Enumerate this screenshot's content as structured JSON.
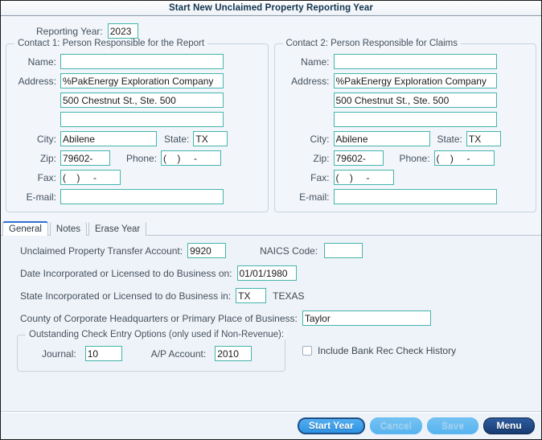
{
  "window": {
    "title": "Start New Unclaimed Property Reporting Year"
  },
  "reporting_year": {
    "label": "Reporting Year:",
    "value": "2023"
  },
  "contact1": {
    "legend": "Contact 1: Person Responsible for the Report",
    "labels": {
      "name": "Name:",
      "address": "Address:",
      "city": "City:",
      "state": "State:",
      "zip": "Zip:",
      "phone": "Phone:",
      "fax": "Fax:",
      "email": "E-mail:"
    },
    "values": {
      "name": "",
      "address1": "%PakEnergy Exploration Company",
      "address2": "500 Chestnut St., Ste. 500",
      "address3": "",
      "city": "Abilene",
      "state": "TX",
      "zip": "79602-",
      "phone": "(    )     -",
      "fax": "(    )     -",
      "email": ""
    }
  },
  "contact2": {
    "legend": "Contact 2: Person Responsible for Claims",
    "labels": {
      "name": "Name:",
      "address": "Address:",
      "city": "City:",
      "state": "State:",
      "zip": "Zip:",
      "phone": "Phone:",
      "fax": "Fax:",
      "email": "E-mail:"
    },
    "values": {
      "name": "",
      "address1": "%PakEnergy Exploration Company",
      "address2": "500 Chestnut St., Ste. 500",
      "address3": "",
      "city": "Abilene",
      "state": "TX",
      "zip": "79602-",
      "phone": "(    )     -",
      "fax": "(    )     -",
      "email": ""
    }
  },
  "tabs": [
    {
      "label": "General",
      "active": true
    },
    {
      "label": "Notes",
      "active": false
    },
    {
      "label": "Erase Year",
      "active": false
    }
  ],
  "general": {
    "transfer_account_label": "Unclaimed Property Transfer Account:",
    "transfer_account_value": "9920",
    "naics_label": "NAICS Code:",
    "naics_value": "",
    "date_incorporated_label": "Date Incorporated or Licensed to do Business on:",
    "date_incorporated_value": "01/01/1980",
    "state_incorporated_label": "State Incorporated or Licensed to do Business in:",
    "state_incorporated_value": "TX",
    "state_incorporated_name": "TEXAS",
    "county_label": "County of Corporate Headquarters or Primary Place of Business:",
    "county_value": "Taylor"
  },
  "outstanding_check": {
    "legend": "Outstanding Check Entry Options (only used if Non-Revenue):",
    "journal_label": "Journal:",
    "journal_value": "10",
    "ap_account_label": "A/P Account:",
    "ap_account_value": "2010",
    "include_bank_rec_label": "Include Bank Rec Check History",
    "include_bank_rec_checked": false
  },
  "buttons": {
    "start_year": "Start Year",
    "cancel": "Cancel",
    "save": "Save",
    "menu": "Menu"
  },
  "colors": {
    "field_border": "#44b4ac",
    "title_text": "#12344f",
    "active_tab_accent": "#2e6fd4",
    "primary_button": "#2e93e3",
    "menu_button": "#173b72",
    "background": "#f2f6fb"
  }
}
